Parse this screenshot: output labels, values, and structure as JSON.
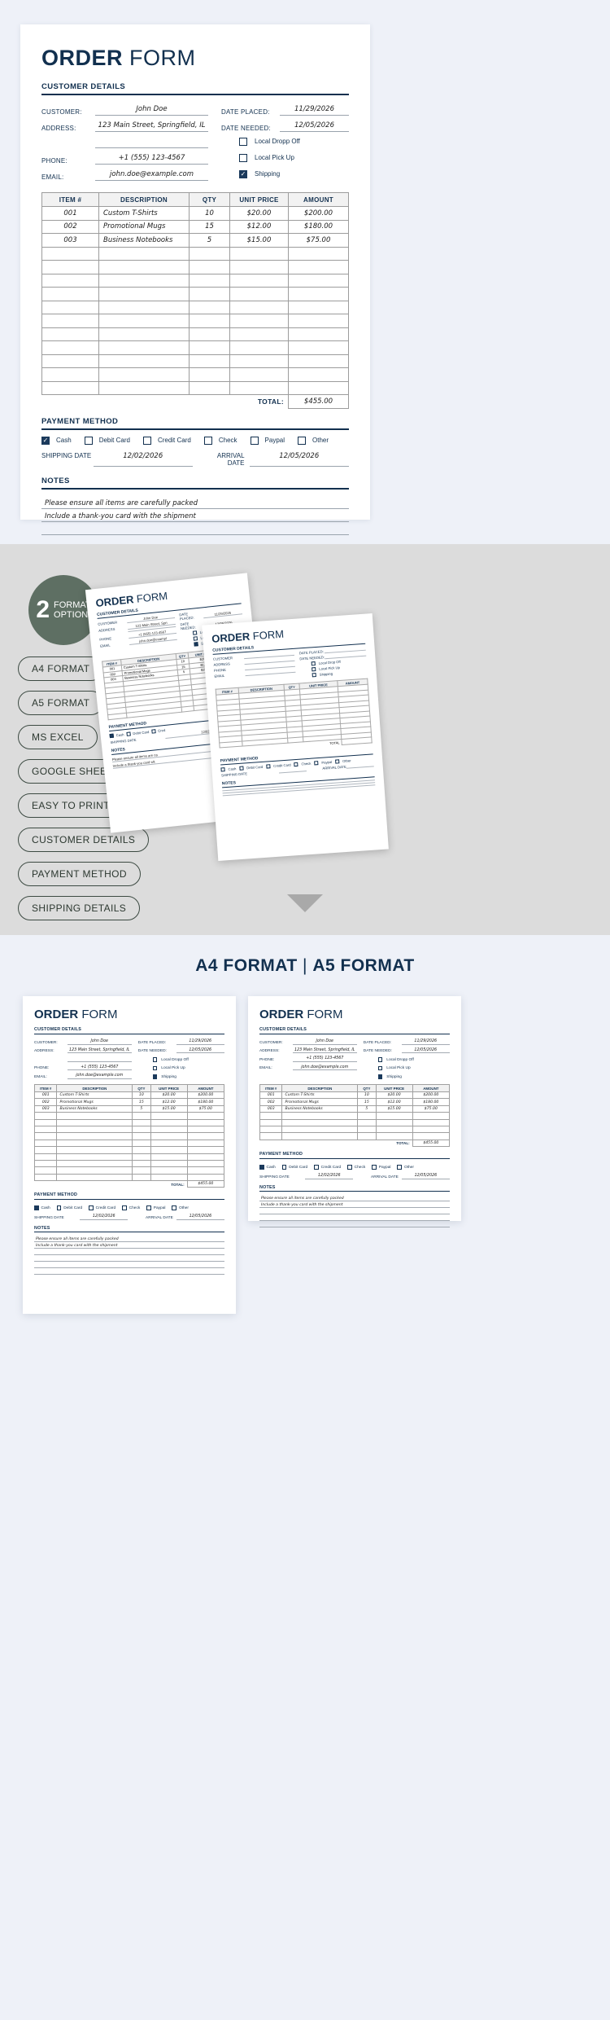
{
  "colors": {
    "navy": "#12304f",
    "accent": "#1b3A5c",
    "badge": "#5e6f63",
    "section_bg": "#dcdcdc",
    "page_bg": "#eef1f8"
  },
  "form": {
    "title_bold": "ORDER",
    "title_light": "FORM",
    "customer_details_heading": "CUSTOMER DETAILS",
    "fields": {
      "customer_label": "CUSTOMER:",
      "customer_value": "John Doe",
      "address_label": "ADDRESS:",
      "address_value": "123 Main Street, Springfield, IL",
      "address_value_2": "",
      "phone_label": "PHONE:",
      "phone_value": "+1 (555) 123-4567",
      "email_label": "EMAIL:",
      "email_value": "john.doe@example.com",
      "date_placed_label": "DATE PLACED:",
      "date_placed_value": "11/29/2026",
      "date_needed_label": "DATE NEEDED:",
      "date_needed_value": "12/05/2026"
    },
    "delivery_options": [
      {
        "label": "Local Dropp Off",
        "checked": false
      },
      {
        "label": "Local Pick Up",
        "checked": false
      },
      {
        "label": "Shipping",
        "checked": true
      }
    ],
    "table": {
      "headers": [
        "ITEM #",
        "DESCRIPTION",
        "QTY",
        "UNIT PRICE",
        "AMOUNT"
      ],
      "rows": [
        {
          "item": "001",
          "desc": "Custom T-Shirts",
          "qty": "10",
          "unit": "$20.00",
          "amount": "$200.00"
        },
        {
          "item": "002",
          "desc": "Promotional Mugs",
          "qty": "15",
          "unit": "$12.00",
          "amount": "$180.00"
        },
        {
          "item": "003",
          "desc": "Business Notebooks",
          "qty": "5",
          "unit": "$15.00",
          "amount": "$75.00"
        }
      ],
      "empty_rows": 11,
      "total_label": "TOTAL:",
      "total_value": "$455.00"
    },
    "payment": {
      "heading": "PAYMENT METHOD",
      "methods": [
        {
          "label": "Cash",
          "checked": true
        },
        {
          "label": "Debit Card",
          "checked": false
        },
        {
          "label": "Credit Card",
          "checked": false
        },
        {
          "label": "Check",
          "checked": false
        },
        {
          "label": "Paypal",
          "checked": false
        },
        {
          "label": "Other",
          "checked": false
        }
      ],
      "shipping_date_label": "SHIPPING DATE",
      "shipping_date_value": "12/02/2026",
      "arrival_date_label": "ARRIVAL DATE",
      "arrival_date_value": "12/05/2026"
    },
    "notes": {
      "heading": "NOTES",
      "lines": [
        "Please ensure all items are carefully packed",
        "Include a thank-you card with the shipment",
        "",
        "",
        "",
        ""
      ]
    }
  },
  "features": {
    "badge_number": "2",
    "badge_line1": "FORMAT",
    "badge_line2": "OPTION",
    "pills": [
      "A4 FORMAT",
      "A5 FORMAT",
      "MS EXCEL",
      "GOOGLE SHEETS",
      "EASY TO PRINT",
      "CUSTOMER DETAILS",
      "PAYMENT METHOD",
      "SHIPPING DETAILS"
    ]
  },
  "compare": {
    "title_a": "A4 FORMAT",
    "separator": " | ",
    "title_b": "A5 FORMAT"
  }
}
